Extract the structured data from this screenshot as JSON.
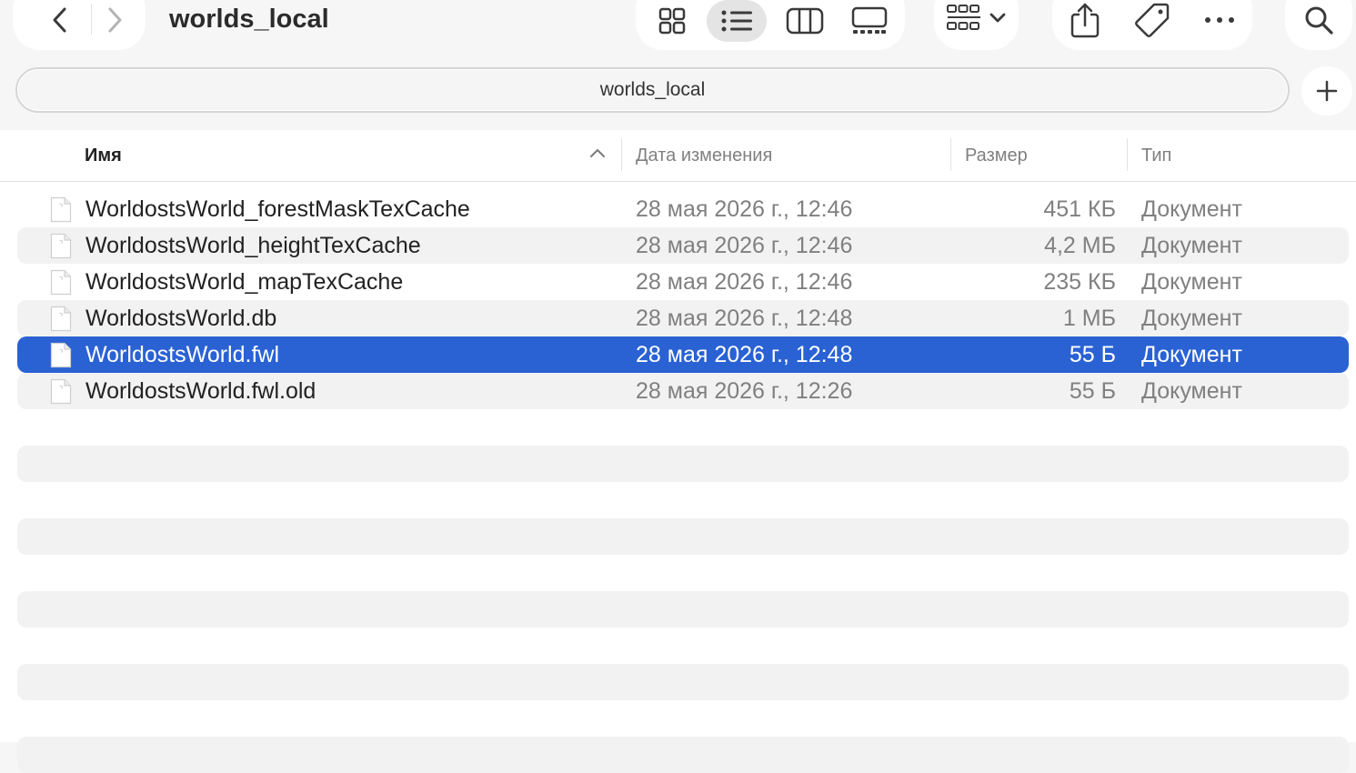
{
  "window": {
    "title": "worlds_local",
    "nav": {
      "back_icon": "chevron-left-icon",
      "forward_icon": "chevron-right-icon"
    },
    "view_modes": [
      {
        "icon": "icon-view-icon",
        "active": false
      },
      {
        "icon": "list-view-icon",
        "active": true
      },
      {
        "icon": "column-view-icon",
        "active": false
      },
      {
        "icon": "gallery-view-icon",
        "active": false
      }
    ],
    "group_icon": "group-grid-icon",
    "actions": [
      "share-icon",
      "tag-icon",
      "more-icon"
    ],
    "search_icon": "search-icon"
  },
  "pathbar": {
    "text": "worlds_local",
    "add_icon": "plus-icon"
  },
  "columns": {
    "name": "Имя",
    "date": "Дата изменения",
    "size": "Размер",
    "kind": "Тип",
    "sort_indicator": "chevron-up-icon"
  },
  "files": [
    {
      "name": "WorldostsWorld_forestMaskTexCache",
      "date": "28 мая 2026 г., 12:46",
      "size": "451 КБ",
      "kind": "Документ"
    },
    {
      "name": "WorldostsWorld_heightTexCache",
      "date": "28 мая 2026 г., 12:46",
      "size": "4,2 МБ",
      "kind": "Документ"
    },
    {
      "name": "WorldostsWorld_mapTexCache",
      "date": "28 мая 2026 г., 12:46",
      "size": "235 КБ",
      "kind": "Документ"
    },
    {
      "name": "WorldostsWorld.db",
      "date": "28 мая 2026 г., 12:48",
      "size": "1 МБ",
      "kind": "Документ"
    },
    {
      "name": "WorldostsWorld.fwl",
      "date": "28 мая 2026 г., 12:48",
      "size": "55 Б",
      "kind": "Документ",
      "selected": true
    },
    {
      "name": "WorldostsWorld.fwl.old",
      "date": "28 мая 2026 г., 12:26",
      "size": "55 Б",
      "kind": "Документ"
    }
  ],
  "colors": {
    "selection": "#2a62d4",
    "alt_row": "#f2f2f2"
  }
}
